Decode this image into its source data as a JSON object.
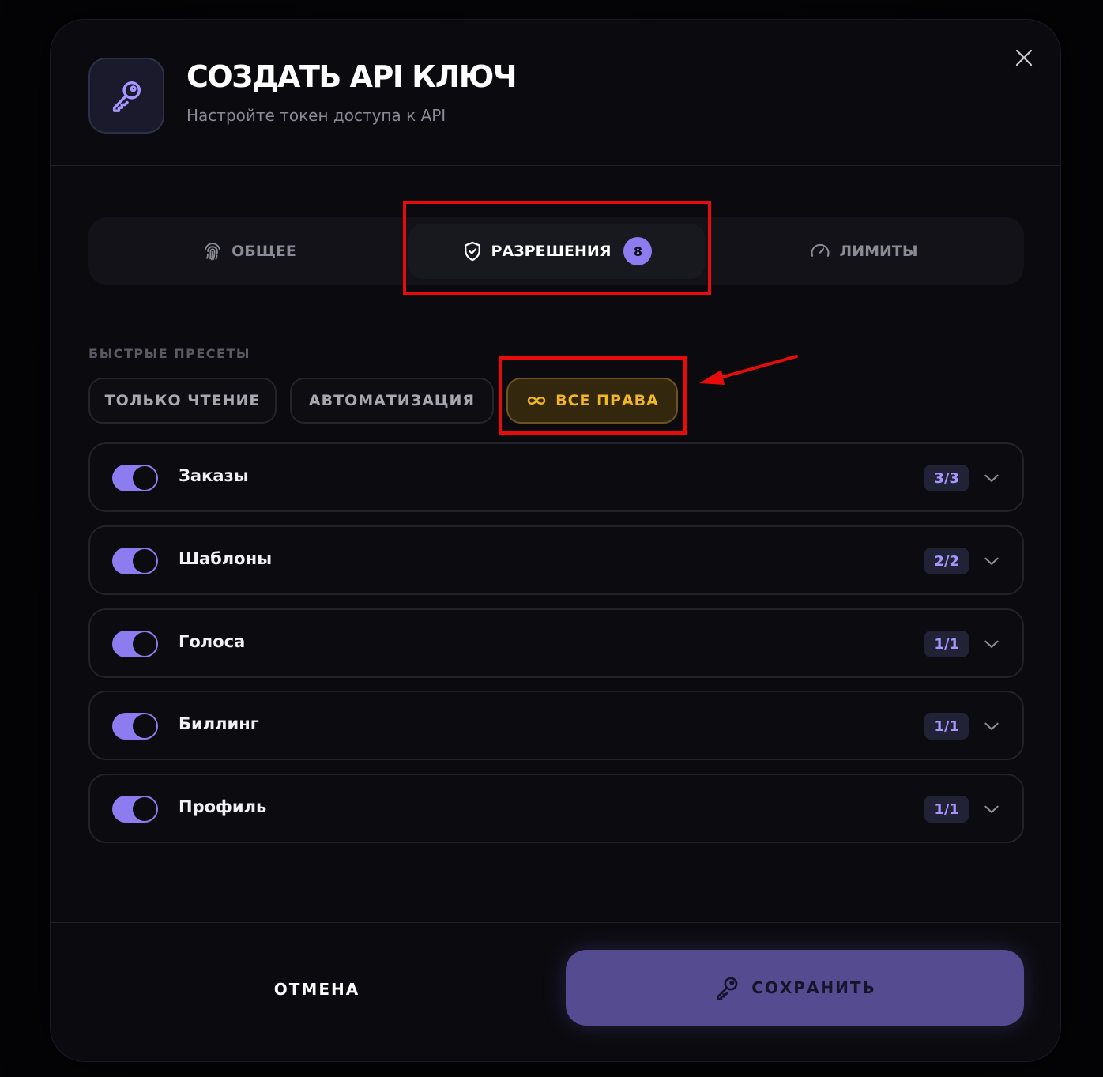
{
  "header": {
    "title": "СОЗДАТЬ API КЛЮЧ",
    "subtitle": "Настройте токен доступа к API"
  },
  "tabs": [
    {
      "label": "ОБЩЕЕ",
      "icon": "fingerprint-icon",
      "active": false
    },
    {
      "label": "РАЗРЕШЕНИЯ",
      "icon": "shield-check-icon",
      "active": true,
      "badge": "8"
    },
    {
      "label": "ЛИМИТЫ",
      "icon": "gauge-icon",
      "active": false
    }
  ],
  "presets": {
    "label": "БЫСТРЫЕ ПРЕСЕТЫ",
    "items": [
      {
        "label": "ТОЛЬКО ЧТЕНИЕ"
      },
      {
        "label": "АВТОМАТИЗАЦИЯ"
      },
      {
        "label": "ВСЕ ПРАВА",
        "icon": "infinity-icon",
        "selected": true
      }
    ]
  },
  "permissions": [
    {
      "label": "Заказы",
      "count": "3/3",
      "enabled": true
    },
    {
      "label": "Шаблоны",
      "count": "2/2",
      "enabled": true
    },
    {
      "label": "Голоса",
      "count": "1/1",
      "enabled": true
    },
    {
      "label": "Биллинг",
      "count": "1/1",
      "enabled": true
    },
    {
      "label": "Профиль",
      "count": "1/1",
      "enabled": true
    }
  ],
  "footer": {
    "cancel_label": "ОТМЕНА",
    "save_label": "СОХРАНИТЬ"
  },
  "colors": {
    "accent": "#8c7cf0",
    "gold": "#f3b625",
    "highlight": "#e80b0b",
    "save_button": "#544b91"
  }
}
